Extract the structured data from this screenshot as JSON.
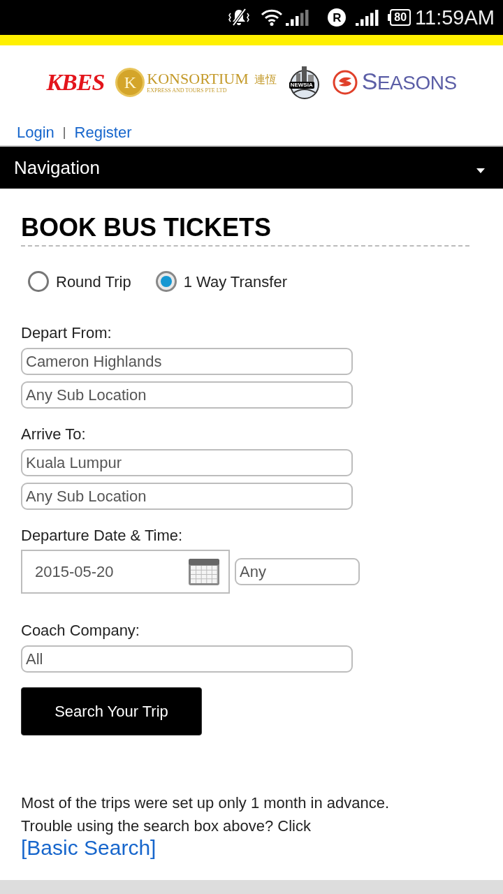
{
  "status_bar": {
    "roaming": "R",
    "battery": "80",
    "time": "11:59AM"
  },
  "logos": [
    {
      "kind": "kbes",
      "text": "KBES"
    },
    {
      "kind": "konsortium",
      "emblem": "K",
      "text": "KONSORTIUM",
      "chinese": "連恆",
      "subtitle": "EXPRESS AND TOURS PTE LTD"
    },
    {
      "kind": "newsia",
      "text": "NEWSIA"
    },
    {
      "kind": "seasons",
      "text": "SEASONS"
    }
  ],
  "account_links": {
    "login": "Login",
    "separator": "|",
    "register": "Register"
  },
  "navigation": {
    "label": "Navigation"
  },
  "form": {
    "title": "BOOK BUS TICKETS",
    "trip_types": [
      {
        "label": "Round Trip",
        "selected": false
      },
      {
        "label": "1 Way Transfer",
        "selected": true
      }
    ],
    "sections": [
      {
        "kind": "stacked",
        "label": "Depart From:",
        "fields": [
          {
            "kind": "select",
            "value": "Cameron Highlands"
          },
          {
            "kind": "select",
            "value": "Any Sub Location"
          }
        ]
      },
      {
        "kind": "stacked",
        "label": "Arrive To:",
        "fields": [
          {
            "kind": "select",
            "value": "Kuala Lumpur"
          },
          {
            "kind": "select",
            "value": "Any Sub Location"
          }
        ]
      },
      {
        "kind": "inline",
        "label": "Departure Date & Time:",
        "fields": [
          {
            "kind": "date",
            "value": "2015-05-20"
          },
          {
            "kind": "select",
            "value": "Any"
          }
        ]
      },
      {
        "kind": "stacked",
        "label": "Coach Company:",
        "fields": [
          {
            "kind": "select",
            "value": "All"
          }
        ]
      }
    ],
    "search_button": "Search Your Trip"
  },
  "note": {
    "lines": [
      "Most of the trips were set up only 1 month in advance.",
      "Trouble using the search box above? Click"
    ],
    "link": "[Basic Search]"
  }
}
